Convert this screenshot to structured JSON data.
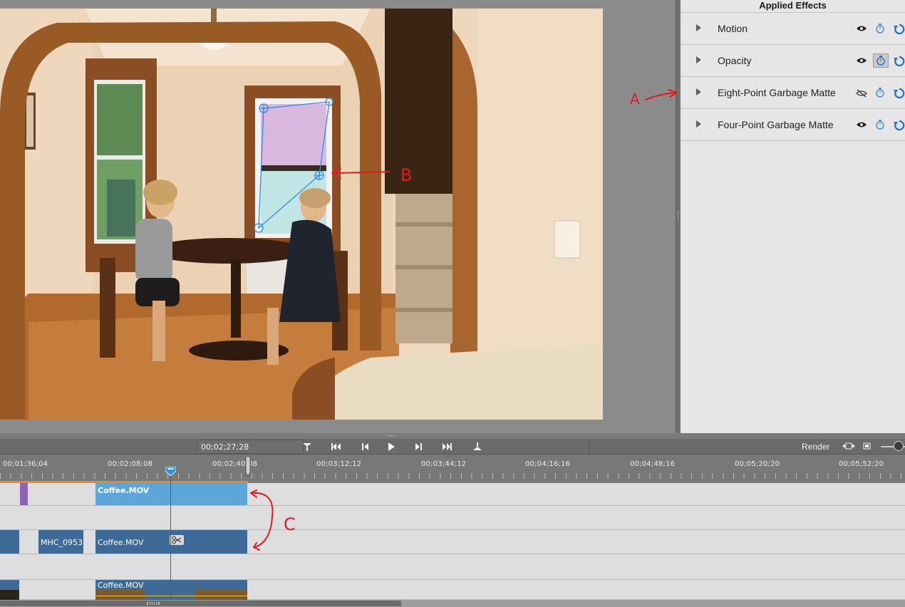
{
  "effects_panel": {
    "title": "Applied Effects",
    "effects": [
      {
        "name": "Motion",
        "visible": true,
        "keyframing": false
      },
      {
        "name": "Opacity",
        "visible": true,
        "keyframing": true
      },
      {
        "name": "Eight-Point Garbage Matte",
        "visible": false,
        "keyframing": false
      },
      {
        "name": "Four-Point Garbage Matte",
        "visible": true,
        "keyframing": false
      }
    ]
  },
  "transport": {
    "timecode": "00;02;27;28",
    "render_label": "Render",
    "buttons": [
      "go-to-in-point",
      "go-to-previous-edit",
      "step-back",
      "play",
      "step-forward",
      "go-to-next-edit",
      "go-to-out-point"
    ]
  },
  "timeline": {
    "ruler_labels": [
      "00;01;36;04",
      "00;02;08;08",
      "00;02;40;08",
      "00;03;12;12",
      "00;03;44;12",
      "00;04;16;16",
      "00;04;48;16",
      "00;05;20;20",
      "00;05;52;20"
    ],
    "clips": {
      "video2_coffee": "Coffee.MOV",
      "video1_mhc": "MHC_0953.",
      "video1_coffee": "Coffee.MOV",
      "audio_coffee": "Coffee.MOV"
    }
  },
  "annotations": {
    "label_a": "A",
    "label_b": "B",
    "label_c": "C"
  },
  "colors": {
    "effects_bg": "#e6e6e6",
    "clip_selected": "#5da6da",
    "clip_normal": "#3e6a97",
    "playhead": "#e0202a",
    "annotation_red": "#e01b1b",
    "mask_line": "#2f8fe0"
  }
}
